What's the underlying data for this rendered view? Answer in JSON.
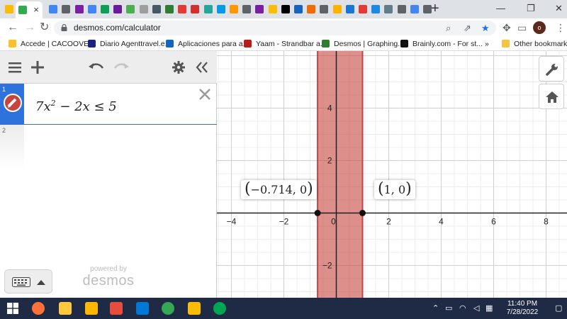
{
  "browser": {
    "tab_icon_colors": [
      "#fbbc04",
      "#34a853",
      "#4285f4",
      "#5f6368",
      "#7b1fa2",
      "#4285f4",
      "#0f9d58",
      "#6a1b9a",
      "#4caf50",
      "#9e9e9e",
      "#455a64",
      "#2e7d32",
      "#e53935",
      "#d32f2f",
      "#26a69a",
      "#039be5",
      "#ff9800",
      "#5f6368",
      "#7b1fa2",
      "#fbbc04",
      "#000000",
      "#1565c0",
      "#ef6c00",
      "#5f6368",
      "#ffb300",
      "#1976d2",
      "#e53935",
      "#1e88e5",
      "#607d8b",
      "#5f6368",
      "#4285f4",
      "#5f6368"
    ],
    "active_tab_close": "×",
    "new_tab": "+",
    "window_controls": {
      "minimize": "—",
      "restore": "❐",
      "close": "✕"
    },
    "url": "desmos.com/calculator",
    "toolbar_icons": [
      "search-icon",
      "share-icon",
      "bookmark-star-icon",
      "extensions-icon",
      "profile-icon",
      "menu-icon"
    ],
    "profile_initial": "o",
    "bookmarks": [
      {
        "label": "Accede | CACOOVE...",
        "color": "#fbc02d"
      },
      {
        "label": "Diario Agenttravel.e...",
        "color": "#1a237e"
      },
      {
        "label": "Aplicaciones para a...",
        "color": "#1565c0"
      },
      {
        "label": "Yaam - Strandbar a...",
        "color": "#b71c1c"
      },
      {
        "label": "Desmos | Graphing...",
        "color": "#2e7d32"
      },
      {
        "label": "Brainly.com - For st...",
        "color": "#111111"
      }
    ],
    "bookmarks_overflow": "»",
    "other_bookmarks": "Other bookmarks"
  },
  "desmos": {
    "expressions": [
      {
        "index": "1",
        "color": "#c74440",
        "latex_base": "7x",
        "latex_exp": "2",
        "latex_rest": " − 2x ≤ 5"
      },
      {
        "index": "2"
      }
    ],
    "powered_by": "powered by",
    "brand": "desmos",
    "graph": {
      "x_ticks": [
        "-4",
        "-2",
        "0",
        "2",
        "4",
        "6",
        "8"
      ],
      "y_ticks": [
        "4",
        "2",
        "-2"
      ],
      "shaded_region": {
        "x_min": -0.714,
        "x_max": 1,
        "color": "#c74440"
      },
      "points": [
        {
          "x": -0.714,
          "y": 0,
          "label_left": "(",
          "label_text": "−0.714, 0",
          "label_right": ")"
        },
        {
          "x": 1,
          "y": 0,
          "label_left": "(",
          "label_text": "1, 0",
          "label_right": ")"
        }
      ]
    }
  },
  "taskbar": {
    "app_colors": [
      "#ff7139",
      "#ffc83d",
      "#ffb900",
      "#e74c3c",
      "#0078d7",
      "#34a853",
      "#fbbc04",
      "#00a651"
    ],
    "time": "11:40 PM",
    "date": "7/28/2022"
  }
}
